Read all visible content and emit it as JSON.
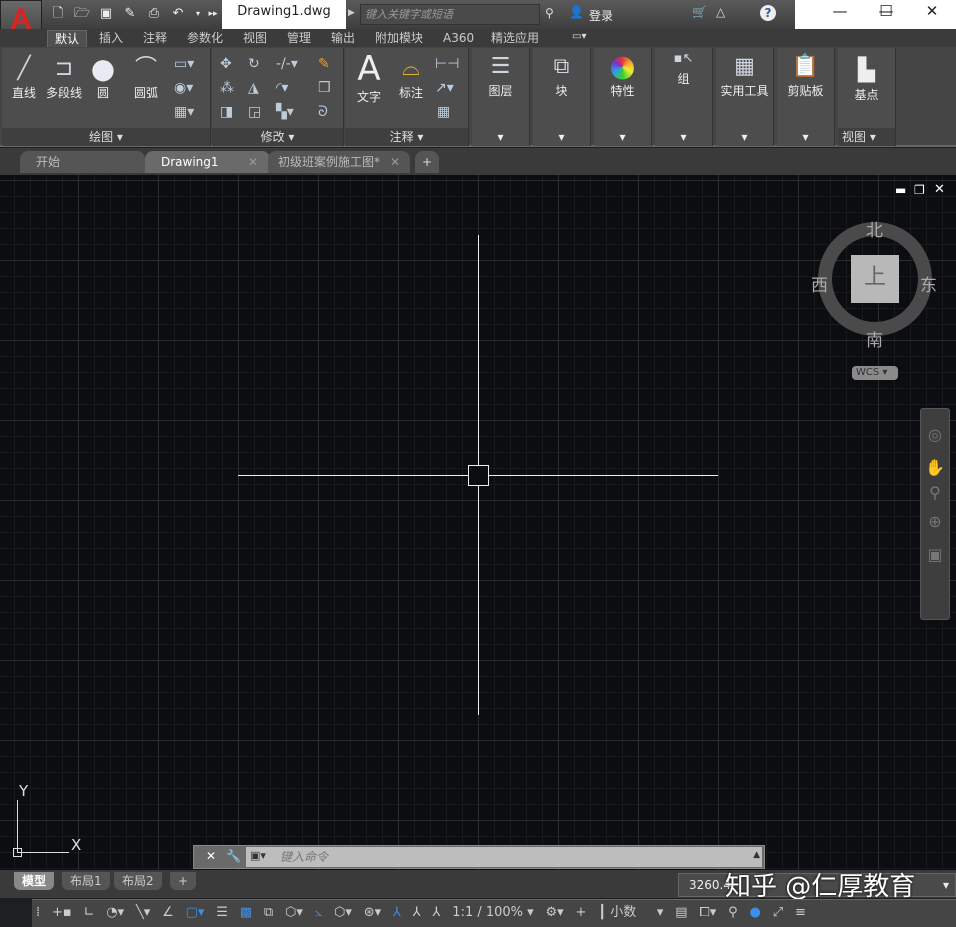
{
  "app": {
    "logo": "A",
    "document_title": "Drawing1.dwg",
    "search_placeholder": "键入关键字或短语",
    "login": "登录"
  },
  "quick_access": [
    "new-icon",
    "open-icon",
    "save-icon",
    "save-as-icon",
    "print-icon",
    "undo-icon"
  ],
  "window_controls": {
    "minimize": "—",
    "maximize": "☐",
    "close": "✕"
  },
  "ribbon_tabs": [
    "默认",
    "插入",
    "注释",
    "参数化",
    "视图",
    "管理",
    "输出",
    "附加模块",
    "A360",
    "精选应用"
  ],
  "panels": {
    "draw": {
      "title": "绘图 ▾",
      "tools": [
        "直线",
        "多段线",
        "圆",
        "圆弧"
      ]
    },
    "modify": {
      "title": "修改 ▾"
    },
    "annotation": {
      "title": "注释 ▾",
      "tools": [
        "文字",
        "标注"
      ]
    },
    "layers": "图层",
    "block": "块",
    "properties": "特性",
    "group": "组",
    "utilities": "实用工具",
    "clipboard": "剪贴板",
    "view": {
      "tool": "基点",
      "title": "视图 ▾"
    }
  },
  "file_tabs": [
    {
      "label": "开始"
    },
    {
      "label": "Drawing1",
      "active": true
    },
    {
      "label": "初级班案例施工图*"
    }
  ],
  "viewcube": {
    "north": "北",
    "south": "南",
    "east": "东",
    "west": "西",
    "face": "上",
    "wcs": "WCS"
  },
  "ucs": {
    "x": "X",
    "y": "Y"
  },
  "command": {
    "placeholder": "键入命令"
  },
  "layout_tabs": [
    "模型",
    "布局1",
    "布局2"
  ],
  "status": {
    "coords": "3260.4",
    "scale": "1:1 / 100%",
    "units": "小数"
  },
  "watermark": "知乎 @仁厚教育",
  "colors": {
    "canvas": "#0c0d10",
    "accent": "#3b8fe6",
    "logo": "#dd2222"
  }
}
